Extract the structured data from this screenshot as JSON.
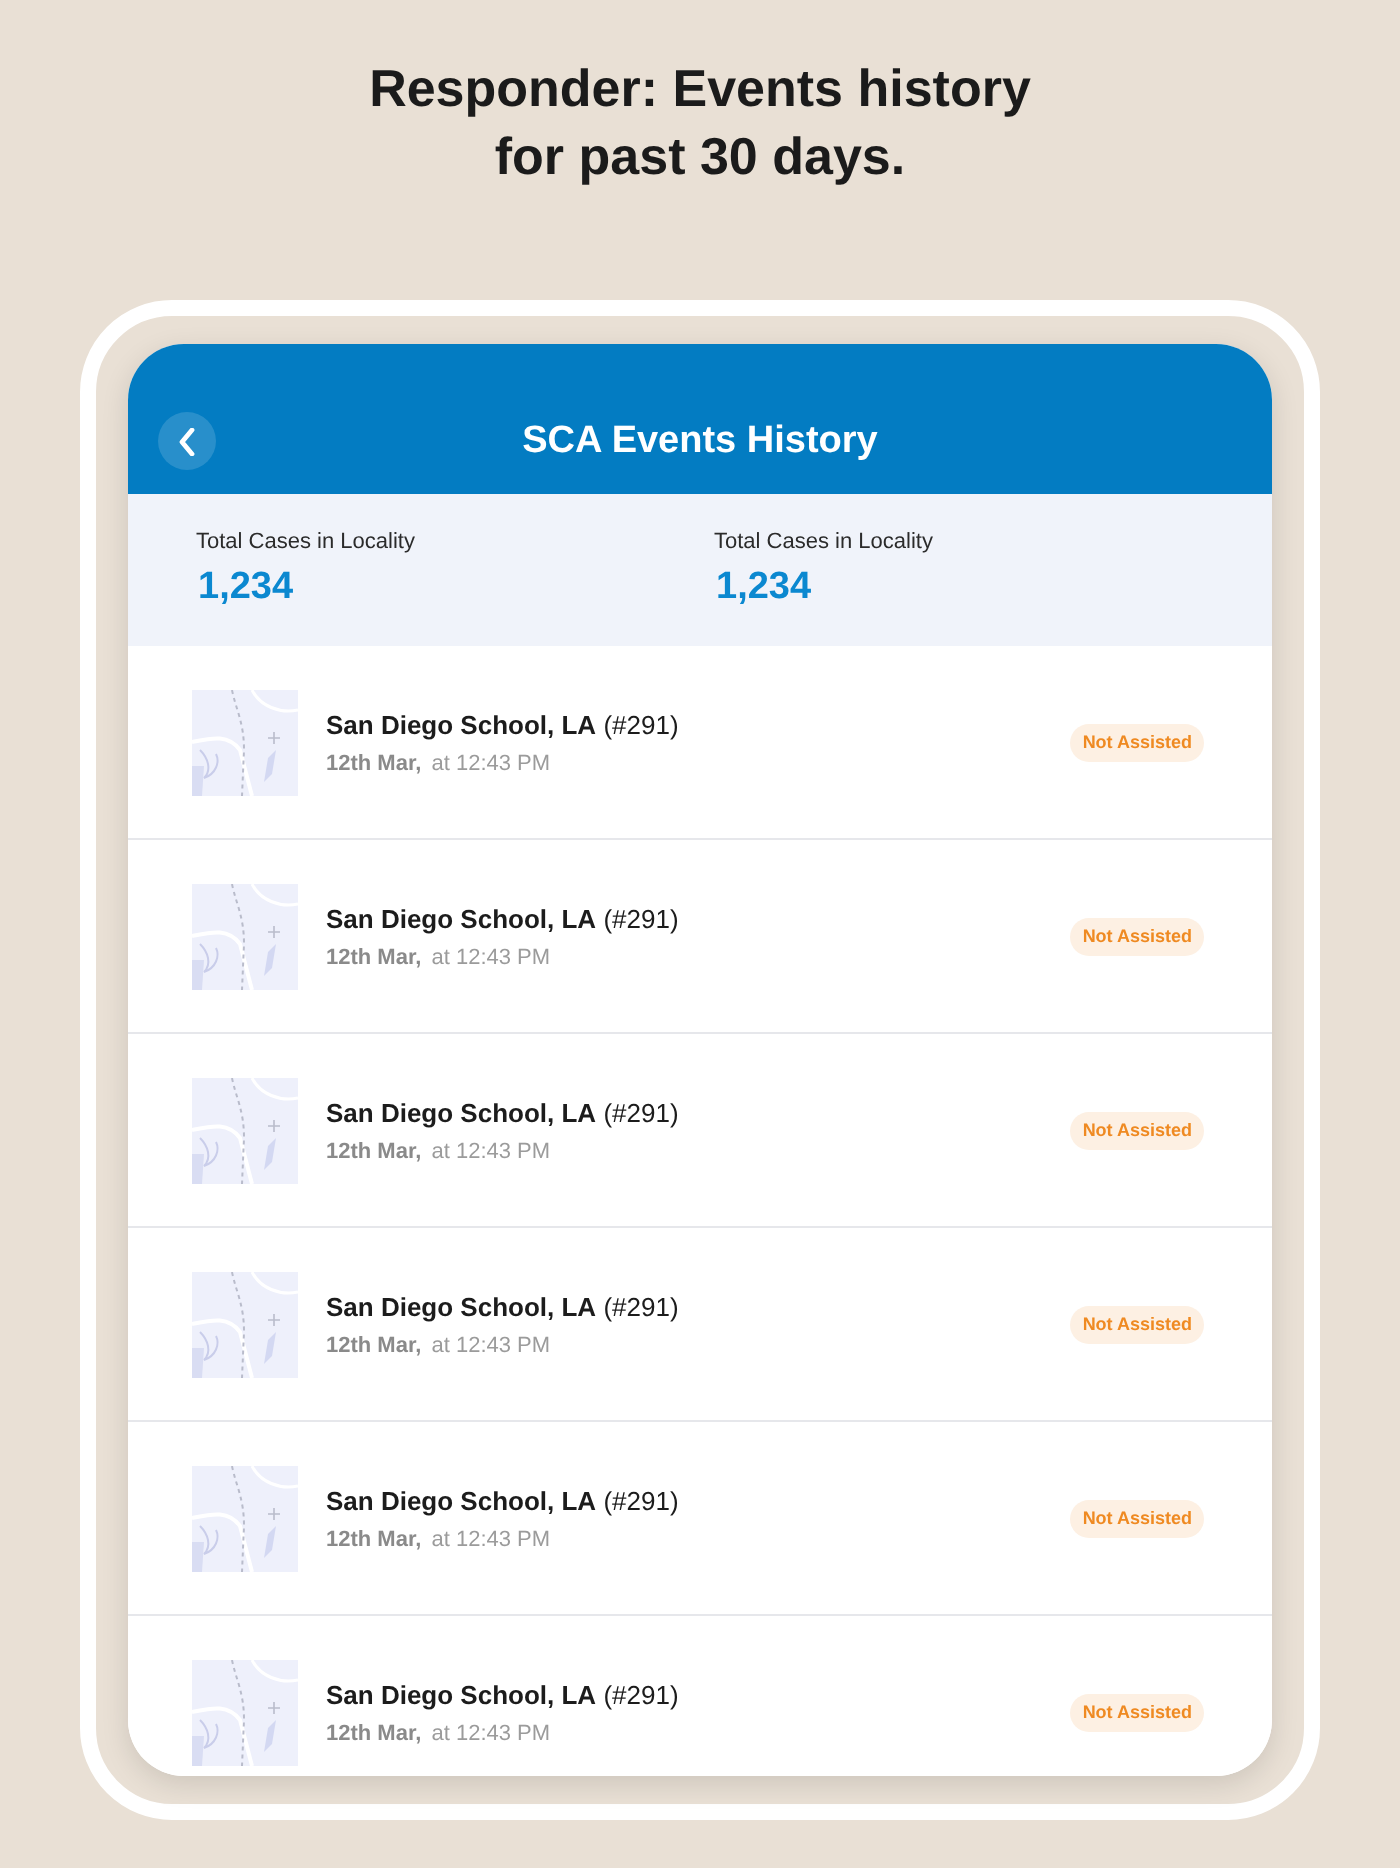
{
  "heading": "Responder: Events history for past 30 days.",
  "screen": {
    "title": "SCA Events History",
    "stats": [
      {
        "label": "Total Cases in Locality",
        "value": "1,234"
      },
      {
        "label": "Total Cases in Locality",
        "value": "1,234"
      }
    ],
    "events": [
      {
        "title": "**San Diego School, LA** (#291)",
        "when": "**12th Mar,** at 12:43 PM",
        "status": {
          "kind": "not_assisted",
          "label": "Not Assisted"
        }
      },
      {
        "title": "**San Diego School, LA** (#291)",
        "when": "**12th Mar,** at 12:43 PM",
        "status": {
          "kind": "not_assisted",
          "label": "Not Assisted"
        }
      },
      {
        "title": "**San Diego School, LA** (#291)",
        "when": "**12th Mar,** at 12:43 PM",
        "status": {
          "kind": "not_assisted",
          "label": "Not Assisted"
        }
      },
      {
        "title": "**San Diego School, LA** (#291)",
        "when": "**12th Mar,** at 12:43 PM",
        "status": {
          "kind": "not_assisted",
          "label": "Not Assisted"
        }
      },
      {
        "title": "**San Diego School, LA** (#291)",
        "when": "**12th Mar,** at 12:43 PM",
        "status": {
          "kind": "not_assisted",
          "label": "Not Assisted"
        }
      },
      {
        "title": "**San Diego School, LA** (#291)",
        "when": "**12th Mar,** at 12:43 PM",
        "status": {
          "kind": "not_assisted",
          "label": "Not Assisted"
        }
      }
    ]
  }
}
